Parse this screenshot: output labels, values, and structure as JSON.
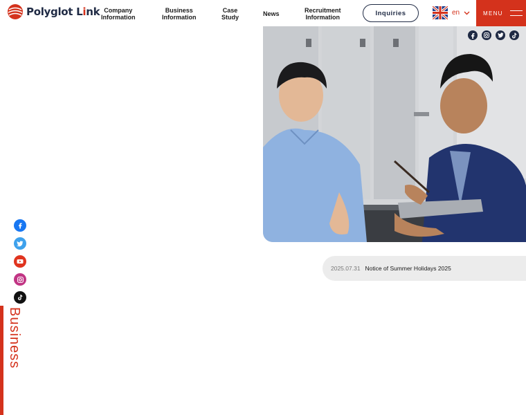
{
  "header": {
    "logo": {
      "word1": "Polyglot L",
      "accent": "i",
      "word2": "nk"
    },
    "nav": [
      {
        "label": "Company\nInformation"
      },
      {
        "label": "Business\nInformation"
      },
      {
        "label": "Case\nStudy"
      },
      {
        "label": "News"
      },
      {
        "label": "Recruitment\nInformation"
      }
    ],
    "inquiries_label": "Inquiries",
    "language": {
      "current": "en",
      "flag_icon": "uk-flag-icon"
    },
    "menu_label": "MENU"
  },
  "social_top": [
    "facebook-icon",
    "instagram-icon",
    "twitter-icon",
    "tiktok-icon"
  ],
  "news": {
    "date": "2025.07.31",
    "title": "Notice of Summer Holidays 2025"
  },
  "social_left": [
    "facebook-icon",
    "twitter-icon",
    "youtube-icon",
    "instagram-icon",
    "tiktok-icon"
  ],
  "side_label": "Business",
  "colors": {
    "accent": "#d4321c",
    "navy": "#1f2a44",
    "news_bg": "#ececec"
  }
}
